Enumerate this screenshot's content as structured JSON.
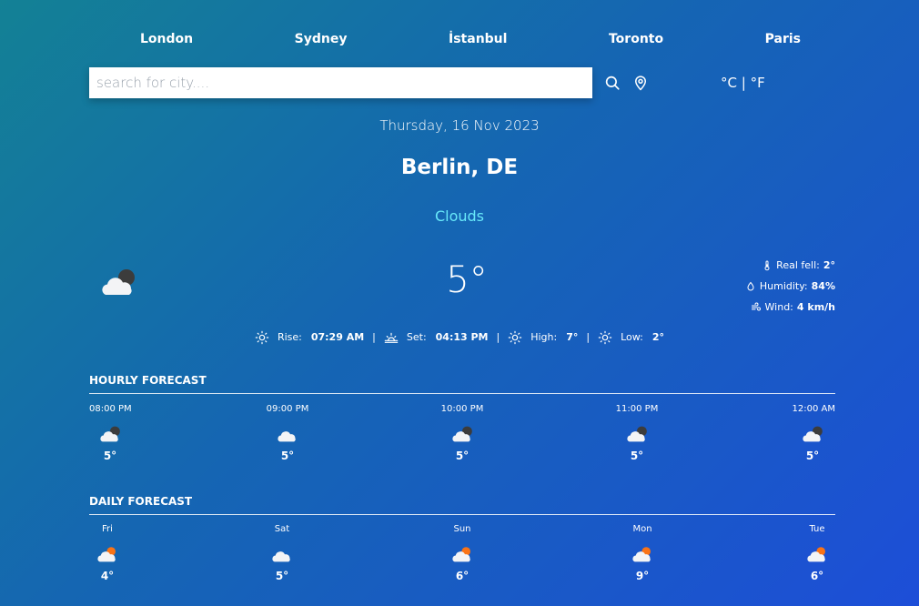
{
  "top_cities": [
    "London",
    "Sydney",
    "İstanbul",
    "Toronto",
    "Paris"
  ],
  "search": {
    "placeholder": "search for city...."
  },
  "units": {
    "celsius": "°C",
    "separator": "|",
    "fahrenheit": "°F"
  },
  "date": "Thursday, 16 Nov 2023",
  "location": "Berlin, DE",
  "condition": "Clouds",
  "current": {
    "icon": "cloud-night-icon",
    "temp": "5°",
    "details": [
      {
        "label": "Real fell:",
        "value": "2°",
        "icon": "thermometer-icon"
      },
      {
        "label": "Humidity:",
        "value": "84%",
        "icon": "droplet-icon"
      },
      {
        "label": "Wind:",
        "value": "4 km/h",
        "icon": "wind-icon"
      }
    ]
  },
  "sun": {
    "rise_label": "Rise:",
    "rise_value": "07:29 AM",
    "set_label": "Set:",
    "set_value": "04:13 PM",
    "high_label": "High:",
    "high_value": "7°",
    "low_label": "Low:",
    "low_value": "2°",
    "separator": "|"
  },
  "hourly": {
    "title": "HOURLY FORECAST",
    "items": [
      {
        "label": "08:00 PM",
        "temp": "5°",
        "icon": "cloud-night-icon"
      },
      {
        "label": "09:00 PM",
        "temp": "5°",
        "icon": "cloud-icon"
      },
      {
        "label": "10:00 PM",
        "temp": "5°",
        "icon": "cloud-night-icon"
      },
      {
        "label": "11:00 PM",
        "temp": "5°",
        "icon": "cloud-night-icon"
      },
      {
        "label": "12:00 AM",
        "temp": "5°",
        "icon": "cloud-night-icon"
      }
    ]
  },
  "daily": {
    "title": "DAILY FORECAST",
    "items": [
      {
        "label": "Fri",
        "temp": "4°",
        "icon": "cloud-sun-icon"
      },
      {
        "label": "Sat",
        "temp": "5°",
        "icon": "cloud-icon"
      },
      {
        "label": "Sun",
        "temp": "6°",
        "icon": "cloud-sun-icon"
      },
      {
        "label": "Mon",
        "temp": "9°",
        "icon": "cloud-sun-icon"
      },
      {
        "label": "Tue",
        "temp": "6°",
        "icon": "cloud-sun-icon"
      }
    ]
  }
}
